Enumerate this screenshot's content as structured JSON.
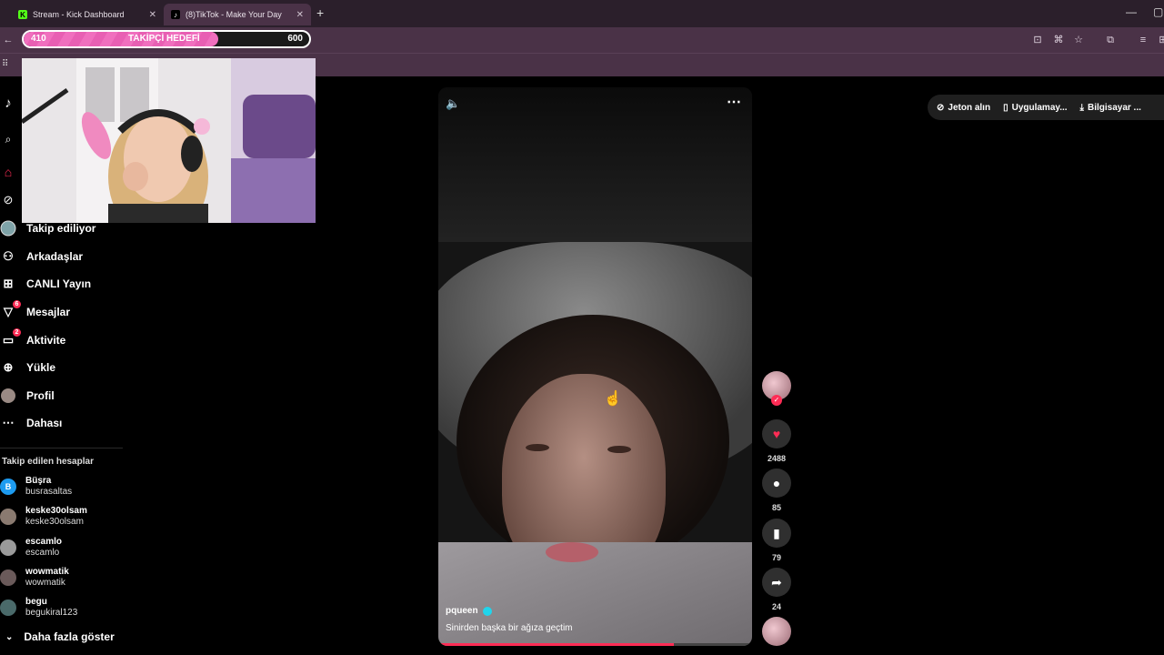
{
  "browser": {
    "tabs": [
      {
        "label": "Stream - Kick Dashboard",
        "icon": "kick-icon"
      },
      {
        "label": "(8)TikTok - Make Your Day",
        "icon": "tiktok-icon"
      }
    ]
  },
  "overlay": {
    "follower_goal": {
      "current": "410",
      "title": "TAKİPÇİ HEDEFİ",
      "target": "600",
      "progress": 0.68
    }
  },
  "sidebar": {
    "items": [
      {
        "label": "Takip ediliyor",
        "icon": "following-avatar-icon"
      },
      {
        "label": "Arkadaşlar",
        "icon": "friends-icon"
      },
      {
        "label": "CANLI Yayın",
        "icon": "live-icon"
      },
      {
        "label": "Mesajlar",
        "icon": "messages-icon",
        "badge": "6"
      },
      {
        "label": "Aktivite",
        "icon": "activity-icon",
        "badge": "2"
      },
      {
        "label": "Yükle",
        "icon": "upload-icon"
      },
      {
        "label": "Profil",
        "icon": "profile-icon"
      },
      {
        "label": "Dahası",
        "icon": "more-icon"
      }
    ],
    "followed_title": "Takip edilen hesaplar",
    "accounts": [
      {
        "name": "Büşra",
        "username": "busrasaltas",
        "avatar_color": "#1d9bf0",
        "initial": "B"
      },
      {
        "name": "keske30olsam",
        "username": "keske30olsam",
        "avatar_color": "#8a7a70"
      },
      {
        "name": "escamlo",
        "username": "escamlo",
        "avatar_color": "#9a9a9a"
      },
      {
        "name": "wowmatik",
        "username": "wowmatik",
        "avatar_color": "#6a5a5a"
      },
      {
        "name": "begu",
        "username": "begukiral123",
        "avatar_color": "#4a6a6a"
      }
    ],
    "show_more": "Daha fazla göster"
  },
  "top_actions": [
    {
      "label": "Jeton alın",
      "icon": "coin-icon"
    },
    {
      "label": "Uygulamay...",
      "icon": "phone-icon"
    },
    {
      "label": "Bilgisayar ...",
      "icon": "download-icon"
    }
  ],
  "video": {
    "username": "pqueen",
    "caption": "Sinirden başka bir ağıza geçtim",
    "progress": 0.75
  },
  "actions": {
    "likes": "2488",
    "comments": "85",
    "saves": "79",
    "shares": "24"
  },
  "colors": {
    "accent": "#fe2c55",
    "browser_frame": "#4a3247",
    "goal_pink": "#f06fbe"
  }
}
